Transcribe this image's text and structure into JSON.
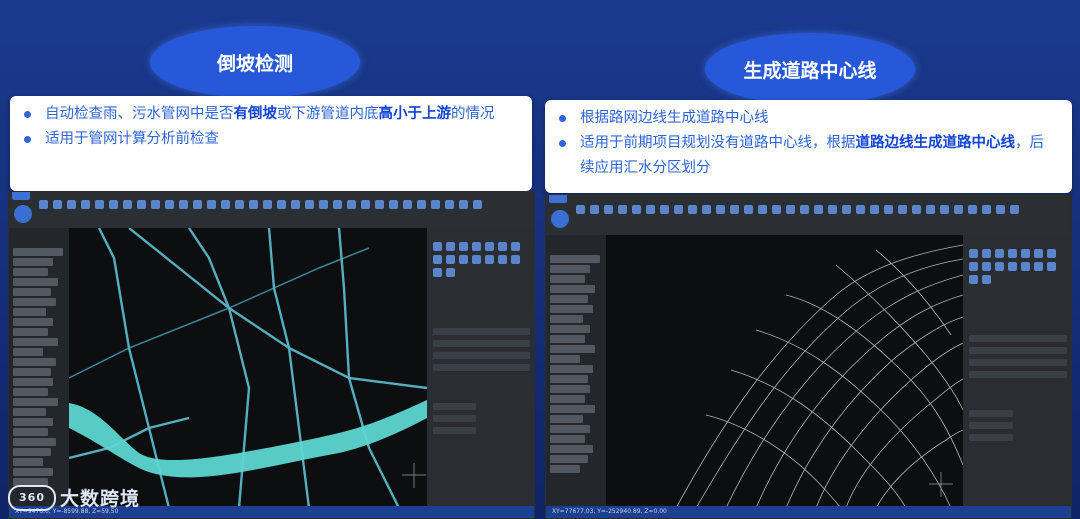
{
  "left": {
    "heading": "倒坡检测",
    "bullets": [
      {
        "parts": [
          {
            "text": "自动检查雨、污水管网中是否",
            "bold": false
          },
          {
            "text": "有倒坡",
            "bold": true
          },
          {
            "text": "或下游管道内底",
            "bold": false
          },
          {
            "text": "高小于上游",
            "bold": true
          },
          {
            "text": "的情况",
            "bold": false
          }
        ]
      },
      {
        "parts": [
          {
            "text": "适用于管网计算分析前检查",
            "bold": false
          }
        ]
      }
    ],
    "statusbar": "XY=9476.0, Y=-8599.88, Z=59.50"
  },
  "right": {
    "heading": "生成道路中心线",
    "bullets": [
      {
        "parts": [
          {
            "text": "根据路网边线生成道路中心线",
            "bold": false
          }
        ]
      },
      {
        "parts": [
          {
            "text": "适用于前期项目规划没有道路中心线，根据",
            "bold": false
          },
          {
            "text": "道路边线生成道路中心线",
            "bold": true
          },
          {
            "text": "，后续应用汇水分区划分",
            "bold": false
          }
        ]
      }
    ],
    "statusbar": "XY=77677.03, Y=-252940.89, Z=0.00"
  },
  "watermark": {
    "logo": "360",
    "text": "大数跨境"
  },
  "colors": {
    "accent": "#2658d9",
    "text": "#2f64d8",
    "bold": "#1144d6",
    "river": "#5ed6d2"
  }
}
